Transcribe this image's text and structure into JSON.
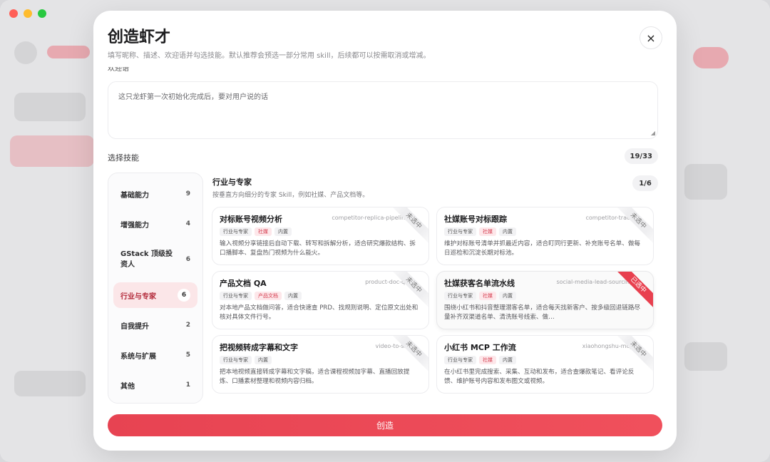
{
  "modal": {
    "title": "创造虾才",
    "subtitle": "填写昵称、描述、欢迎语并勾选技能。默认推荐会预选一部分常用 skill，后续都可以按需取消或增减。",
    "close_icon": "×",
    "cutoff_label": "欢迎语",
    "welcome_placeholder": "这只龙虾第一次初始化完成后，要对用户说的话",
    "skills_label": "选择技能",
    "skills_count": "19/33",
    "create_label": "创造"
  },
  "categories": [
    {
      "label": "基础能力",
      "count": "9",
      "active": false
    },
    {
      "label": "增强能力",
      "count": "4",
      "active": false
    },
    {
      "label": "GStack 顶级投资人",
      "count": "6",
      "active": false
    },
    {
      "label": "行业与专家",
      "count": "6",
      "active": true
    },
    {
      "label": "自我提升",
      "count": "2",
      "active": false
    },
    {
      "label": "系统与扩展",
      "count": "5",
      "active": false
    },
    {
      "label": "其他",
      "count": "1",
      "active": false
    }
  ],
  "section": {
    "title": "行业与专家",
    "desc": "按垂直方向细分的专家 Skill，例如社媒、产品文档等。",
    "page": "1/6"
  },
  "cards": [
    {
      "name": "对标账号视频分析",
      "slug": "competitor-replica-pipeline",
      "tags": [
        "行业与专家",
        "社媒",
        "内置"
      ],
      "desc": "输入视频分享链接后自动下载、转写和拆解分析，适合研究爆款结构、拆口播脚本、复盘热门视频为什么能火。",
      "status": "未选中"
    },
    {
      "name": "社媒账号对标跟踪",
      "slug": "competitor-track",
      "tags": [
        "行业与专家",
        "社媒",
        "内置"
      ],
      "desc": "维护对标账号清单并抓最近内容，适合盯同行更新、补充账号名单、做每日巡检和沉淀长期对标池。",
      "status": "未选中"
    },
    {
      "name": "产品文档 QA",
      "slug": "product-doc-qa",
      "tags": [
        "行业与专家",
        "产品文档",
        "内置"
      ],
      "desc": "对本地产品文档做问答，适合快速查 PRD、找规则说明、定位原文出处和核对具体文件行号。",
      "status": "未选中"
    },
    {
      "name": "社媒获客名单流水线",
      "slug": "social-media-lead-sourcing",
      "tags": [
        "行业与专家",
        "社媒",
        "内置"
      ],
      "desc": "围绕小红书和抖音整理潜客名单，适合每天找新客户、按多级回退链路尽量补齐双渠道名单、清洗账号线索、做…",
      "status": "已选中"
    },
    {
      "name": "把视频转成字幕和文字",
      "slug": "video-to-srt",
      "tags": [
        "行业与专家",
        "内置"
      ],
      "desc": "把本地视频直接转成字幕和文字稿，适合课程视频加字幕、直播回放提炼、口播素材整理和视频内容归档。",
      "status": "未选中"
    },
    {
      "name": "小红书 MCP 工作流",
      "slug": "xiaohongshu-mcp",
      "tags": [
        "行业与专家",
        "社媒",
        "内置"
      ],
      "desc": "在小红书里完成搜索、采集、互动和发布，适合查爆款笔记、看评论反馈、维护账号内容和发布图文或视频。",
      "status": "未选中"
    }
  ]
}
